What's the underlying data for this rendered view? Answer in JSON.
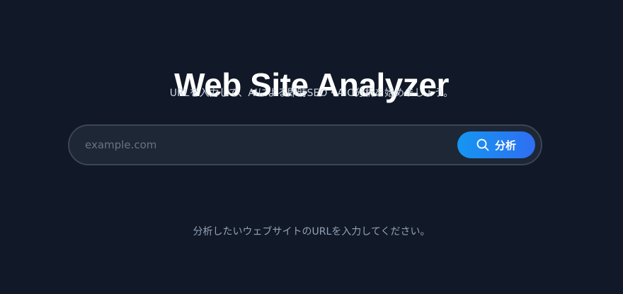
{
  "header": {
    "title": "Web Site Analyzer",
    "subtitle": "URLを入力して、AIによる即時SEO・AIO分析を始めましょう。"
  },
  "search": {
    "placeholder": "example.com",
    "value": "",
    "button_label": "分析",
    "button_icon": "search-icon"
  },
  "hint": {
    "text": "分析したいウェブサイトのURLを入力してください。"
  },
  "colors": {
    "background": "#111827",
    "accent_start": "#1596f0",
    "accent_end": "#2f6ef2"
  }
}
